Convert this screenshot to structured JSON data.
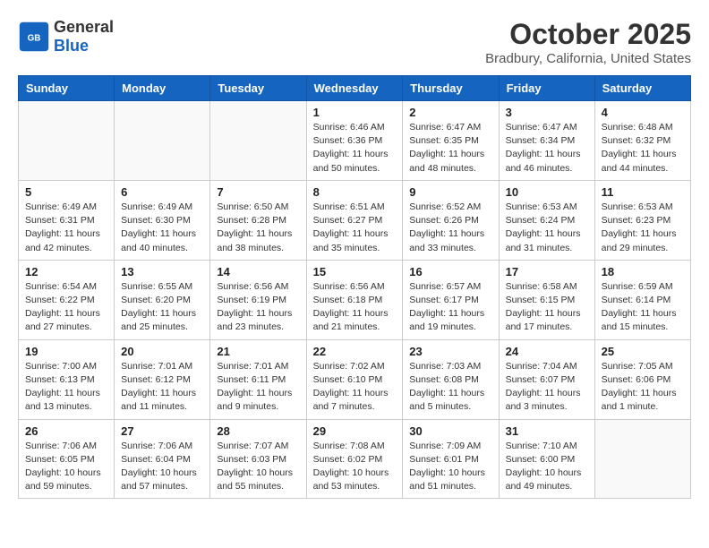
{
  "header": {
    "logo_general": "General",
    "logo_blue": "Blue",
    "month": "October 2025",
    "location": "Bradbury, California, United States"
  },
  "weekdays": [
    "Sunday",
    "Monday",
    "Tuesday",
    "Wednesday",
    "Thursday",
    "Friday",
    "Saturday"
  ],
  "weeks": [
    [
      {
        "day": "",
        "info": ""
      },
      {
        "day": "",
        "info": ""
      },
      {
        "day": "",
        "info": ""
      },
      {
        "day": "1",
        "info": "Sunrise: 6:46 AM\nSunset: 6:36 PM\nDaylight: 11 hours\nand 50 minutes."
      },
      {
        "day": "2",
        "info": "Sunrise: 6:47 AM\nSunset: 6:35 PM\nDaylight: 11 hours\nand 48 minutes."
      },
      {
        "day": "3",
        "info": "Sunrise: 6:47 AM\nSunset: 6:34 PM\nDaylight: 11 hours\nand 46 minutes."
      },
      {
        "day": "4",
        "info": "Sunrise: 6:48 AM\nSunset: 6:32 PM\nDaylight: 11 hours\nand 44 minutes."
      }
    ],
    [
      {
        "day": "5",
        "info": "Sunrise: 6:49 AM\nSunset: 6:31 PM\nDaylight: 11 hours\nand 42 minutes."
      },
      {
        "day": "6",
        "info": "Sunrise: 6:49 AM\nSunset: 6:30 PM\nDaylight: 11 hours\nand 40 minutes."
      },
      {
        "day": "7",
        "info": "Sunrise: 6:50 AM\nSunset: 6:28 PM\nDaylight: 11 hours\nand 38 minutes."
      },
      {
        "day": "8",
        "info": "Sunrise: 6:51 AM\nSunset: 6:27 PM\nDaylight: 11 hours\nand 35 minutes."
      },
      {
        "day": "9",
        "info": "Sunrise: 6:52 AM\nSunset: 6:26 PM\nDaylight: 11 hours\nand 33 minutes."
      },
      {
        "day": "10",
        "info": "Sunrise: 6:53 AM\nSunset: 6:24 PM\nDaylight: 11 hours\nand 31 minutes."
      },
      {
        "day": "11",
        "info": "Sunrise: 6:53 AM\nSunset: 6:23 PM\nDaylight: 11 hours\nand 29 minutes."
      }
    ],
    [
      {
        "day": "12",
        "info": "Sunrise: 6:54 AM\nSunset: 6:22 PM\nDaylight: 11 hours\nand 27 minutes."
      },
      {
        "day": "13",
        "info": "Sunrise: 6:55 AM\nSunset: 6:20 PM\nDaylight: 11 hours\nand 25 minutes."
      },
      {
        "day": "14",
        "info": "Sunrise: 6:56 AM\nSunset: 6:19 PM\nDaylight: 11 hours\nand 23 minutes."
      },
      {
        "day": "15",
        "info": "Sunrise: 6:56 AM\nSunset: 6:18 PM\nDaylight: 11 hours\nand 21 minutes."
      },
      {
        "day": "16",
        "info": "Sunrise: 6:57 AM\nSunset: 6:17 PM\nDaylight: 11 hours\nand 19 minutes."
      },
      {
        "day": "17",
        "info": "Sunrise: 6:58 AM\nSunset: 6:15 PM\nDaylight: 11 hours\nand 17 minutes."
      },
      {
        "day": "18",
        "info": "Sunrise: 6:59 AM\nSunset: 6:14 PM\nDaylight: 11 hours\nand 15 minutes."
      }
    ],
    [
      {
        "day": "19",
        "info": "Sunrise: 7:00 AM\nSunset: 6:13 PM\nDaylight: 11 hours\nand 13 minutes."
      },
      {
        "day": "20",
        "info": "Sunrise: 7:01 AM\nSunset: 6:12 PM\nDaylight: 11 hours\nand 11 minutes."
      },
      {
        "day": "21",
        "info": "Sunrise: 7:01 AM\nSunset: 6:11 PM\nDaylight: 11 hours\nand 9 minutes."
      },
      {
        "day": "22",
        "info": "Sunrise: 7:02 AM\nSunset: 6:10 PM\nDaylight: 11 hours\nand 7 minutes."
      },
      {
        "day": "23",
        "info": "Sunrise: 7:03 AM\nSunset: 6:08 PM\nDaylight: 11 hours\nand 5 minutes."
      },
      {
        "day": "24",
        "info": "Sunrise: 7:04 AM\nSunset: 6:07 PM\nDaylight: 11 hours\nand 3 minutes."
      },
      {
        "day": "25",
        "info": "Sunrise: 7:05 AM\nSunset: 6:06 PM\nDaylight: 11 hours\nand 1 minute."
      }
    ],
    [
      {
        "day": "26",
        "info": "Sunrise: 7:06 AM\nSunset: 6:05 PM\nDaylight: 10 hours\nand 59 minutes."
      },
      {
        "day": "27",
        "info": "Sunrise: 7:06 AM\nSunset: 6:04 PM\nDaylight: 10 hours\nand 57 minutes."
      },
      {
        "day": "28",
        "info": "Sunrise: 7:07 AM\nSunset: 6:03 PM\nDaylight: 10 hours\nand 55 minutes."
      },
      {
        "day": "29",
        "info": "Sunrise: 7:08 AM\nSunset: 6:02 PM\nDaylight: 10 hours\nand 53 minutes."
      },
      {
        "day": "30",
        "info": "Sunrise: 7:09 AM\nSunset: 6:01 PM\nDaylight: 10 hours\nand 51 minutes."
      },
      {
        "day": "31",
        "info": "Sunrise: 7:10 AM\nSunset: 6:00 PM\nDaylight: 10 hours\nand 49 minutes."
      },
      {
        "day": "",
        "info": ""
      }
    ]
  ]
}
